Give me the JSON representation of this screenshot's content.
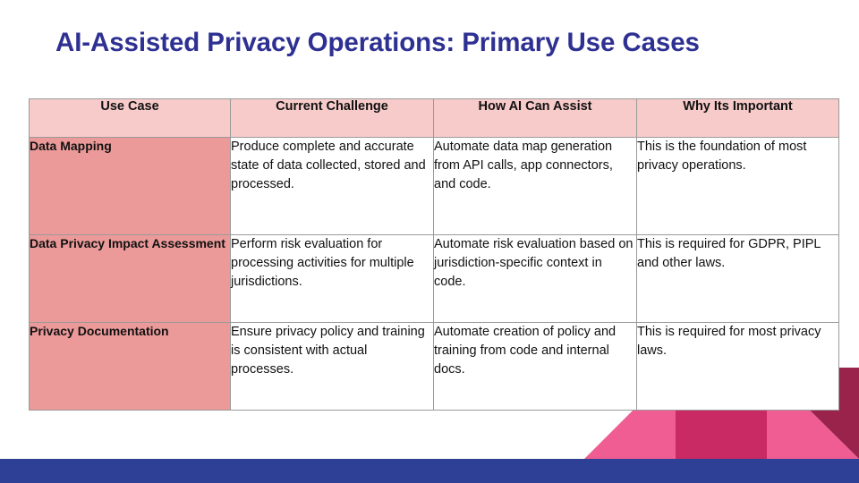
{
  "slide": {
    "title": "AI-Assisted Privacy Operations: Primary Use Cases",
    "accent_blue": "#2e3192",
    "footer_blue": "#2e3f96",
    "header_pink": "#f7cbca",
    "usecase_pink": "#eb9a99",
    "decor_pink_light": "#ef5d92",
    "decor_pink_dark": "#c92a63",
    "decor_maroon": "#99234b"
  },
  "table": {
    "headers": [
      "Use Case",
      "Current Challenge",
      "How AI Can Assist",
      "Why Its Important"
    ],
    "rows": [
      {
        "use_case": "Data Mapping",
        "current_challenge": "Produce complete and accurate state of data collected, stored and processed.",
        "how_ai_can_assist": "Automate data map generation from API calls, app connectors, and code.",
        "why_its_important": "This is the foundation of most privacy operations."
      },
      {
        "use_case": "Data Privacy Impact Assessment",
        "current_challenge": "Perform risk evaluation for processing activities for multiple jurisdictions.",
        "how_ai_can_assist": "Automate risk evaluation based on jurisdiction-specific context in code.",
        "why_its_important": "This is required for GDPR, PIPL and other laws."
      },
      {
        "use_case": "Privacy Documentation",
        "current_challenge": "Ensure privacy policy and training is consistent with actual processes.",
        "how_ai_can_assist": "Automate creation of policy and training from code and internal docs.",
        "why_its_important": "This is required for most privacy laws."
      }
    ]
  }
}
